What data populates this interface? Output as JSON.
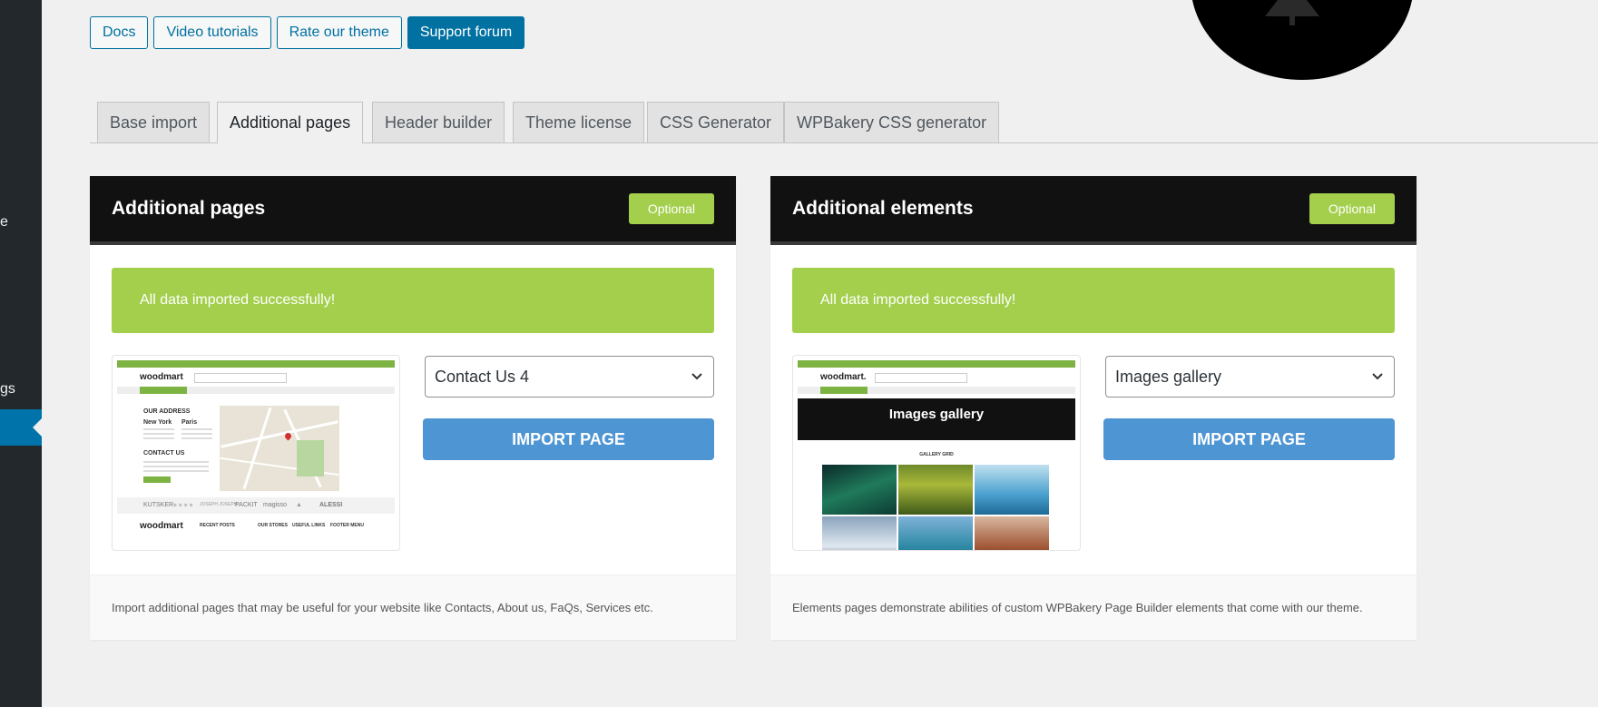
{
  "sidebar": {
    "fragment_1": "e",
    "fragment_2": "gs"
  },
  "top_buttons": [
    {
      "label": "Docs"
    },
    {
      "label": "Video tutorials"
    },
    {
      "label": "Rate our theme"
    },
    {
      "label": "Support forum"
    }
  ],
  "tabs": [
    {
      "label": "Base import",
      "active": false
    },
    {
      "label": "Additional pages",
      "active": true
    },
    {
      "label": "Header builder",
      "active": false
    },
    {
      "label": "Theme license",
      "active": false
    },
    {
      "label": "CSS Generator",
      "active": false
    },
    {
      "label": "WPBakery CSS generator",
      "active": false
    }
  ],
  "panels": [
    {
      "title": "Additional pages",
      "badge": "Optional",
      "success": "All data imported successfully!",
      "select_value": "Contact Us 4",
      "button": "IMPORT PAGE",
      "footer": "Import additional pages that may be useful for your website like Contacts, About us, FaQs, Services etc.",
      "preview": {
        "logo": "woodmart",
        "heading_1": "OUR ADDRESS",
        "city_1": "New York",
        "city_2": "Paris",
        "heading_2": "CONTACT US",
        "brands": [
          "KUTSKER",
          "✶✶✶✶",
          "JOSEPH JOSEPH",
          "PACKIT",
          "magisso",
          "▲",
          "ALESSI"
        ],
        "footer_cols": [
          "RECENT POSTS",
          "OUR STORES",
          "USEFUL LINKS",
          "FOOTER MENU"
        ]
      }
    },
    {
      "title": "Additional elements",
      "badge": "Optional",
      "success": "All data imported successfully!",
      "select_value": "Images gallery",
      "button": "IMPORT PAGE",
      "footer": "Elements pages demonstrate abilities of custom WPBakery Page Builder elements that come with our theme.",
      "preview": {
        "logo": "woodmart.",
        "banner": "Images gallery",
        "subheading": "GALLERY GRID"
      }
    }
  ],
  "colors": {
    "accent": "#0071a1",
    "optional_badge": "#a3cf4c",
    "success": "#a3cf4c",
    "import_button": "#4e95d4",
    "panel_header": "#111111"
  },
  "icons": {
    "select_arrow": "chevron-down-icon"
  }
}
